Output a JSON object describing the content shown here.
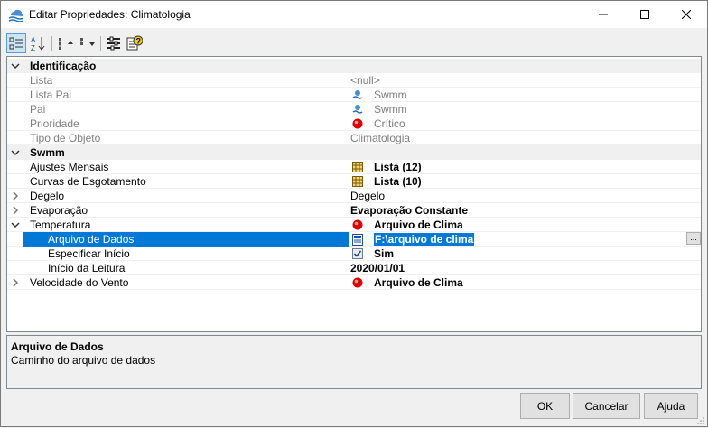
{
  "window": {
    "title": "Editar Propriedades: Climatologia",
    "icon": "stormwater-app-icon",
    "controls": [
      "minimize",
      "maximize",
      "close"
    ]
  },
  "toolbar": {
    "buttons": [
      "categorized-view-icon",
      "alphabetical-sort-icon",
      "expand-all-icon",
      "collapse-all-icon",
      "property-pages-icon",
      "help-tooltip-icon"
    ]
  },
  "grid": {
    "categories": [
      {
        "label": "Identificação",
        "rows": [
          {
            "name": "Lista",
            "value": "<null>",
            "icon": ""
          },
          {
            "name": "Lista Pai",
            "value": "Swmm",
            "icon": "swmm-icon"
          },
          {
            "name": "Pai",
            "value": "Swmm",
            "icon": "swmm-icon"
          },
          {
            "name": "Prioridade",
            "value": "Crítico",
            "icon": "red-circle-icon"
          },
          {
            "name": "Tipo de Objeto",
            "value": "Climatologia",
            "icon": ""
          }
        ]
      },
      {
        "label": "Swmm",
        "rows": [
          {
            "name": "Ajustes Mensais",
            "value": "Lista (12)",
            "icon": "grid-list-icon"
          },
          {
            "name": "Curvas de Esgotamento",
            "value": "Lista (10)",
            "icon": "grid-list-icon"
          },
          {
            "name": "Degelo",
            "value": "Degelo",
            "icon": ""
          },
          {
            "name": "Evaporação",
            "value": "Evaporação Constante",
            "icon": ""
          },
          {
            "name": "Temperatura",
            "value": "Arquivo de Clima",
            "icon": "red-circle-icon"
          },
          {
            "name": "Arquivo de Dados",
            "value": "F:\\arquivo de clima",
            "icon": "file-icon"
          },
          {
            "name": "Especificar Início",
            "value": "Sim",
            "icon": "checkbox-icon"
          },
          {
            "name": "Início da Leitura",
            "value": "2020/01/01",
            "icon": ""
          },
          {
            "name": "Velocidade do Vento",
            "value": "Arquivo de Clima",
            "icon": "red-circle-icon"
          }
        ]
      }
    ],
    "ellipsis_label": "..."
  },
  "help": {
    "title": "Arquivo de Dados",
    "description": "Caminho do arquivo de dados"
  },
  "buttons": {
    "ok": "OK",
    "cancel": "Cancelar",
    "help": "Ajuda"
  },
  "colors": {
    "selection": "#0078d7",
    "readonly_text": "#7f7f7f",
    "category_bg": "#f0f0f0"
  }
}
